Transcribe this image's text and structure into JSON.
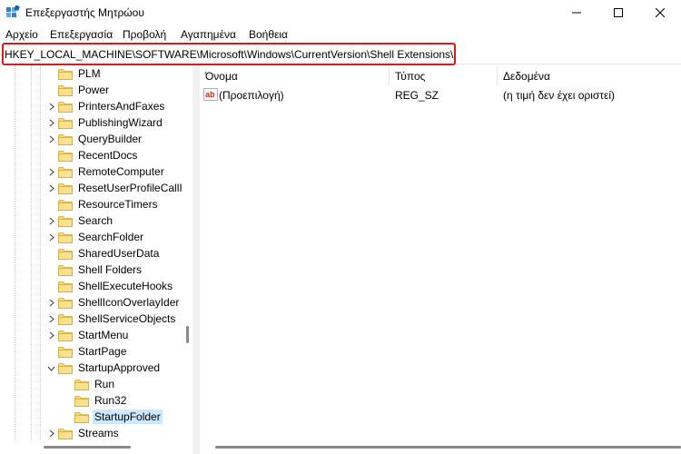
{
  "window": {
    "title": "Επεξεργαστής Μητρώου",
    "controls": {
      "minimize_icon": "minimize-icon",
      "maximize_icon": "maximize-icon",
      "close_icon": "close-icon"
    }
  },
  "menu": [
    "Αρχείο",
    "Επεξεργασία",
    "Προβολή",
    "Αγαπημένα",
    "Βοήθεια"
  ],
  "address": {
    "path": "HKEY_LOCAL_MACHINE\\SOFTWARE\\Microsoft\\Windows\\CurrentVersion\\Shell Extensions\\"
  },
  "tree": {
    "items": [
      {
        "label": "PLM",
        "expander": "none"
      },
      {
        "label": "Power",
        "expander": "none"
      },
      {
        "label": "PrintersAndFaxes",
        "expander": "collapsed"
      },
      {
        "label": "PublishingWizard",
        "expander": "collapsed"
      },
      {
        "label": "QueryBuilder",
        "expander": "collapsed"
      },
      {
        "label": "RecentDocs",
        "expander": "none"
      },
      {
        "label": "RemoteComputer",
        "expander": "collapsed"
      },
      {
        "label": "ResetUserProfileCallI",
        "expander": "collapsed"
      },
      {
        "label": "ResourceTimers",
        "expander": "none"
      },
      {
        "label": "Search",
        "expander": "collapsed"
      },
      {
        "label": "SearchFolder",
        "expander": "collapsed"
      },
      {
        "label": "SharedUserData",
        "expander": "none"
      },
      {
        "label": "Shell Folders",
        "expander": "none"
      },
      {
        "label": "ShellExecuteHooks",
        "expander": "none"
      },
      {
        "label": "ShellIconOverlayIder",
        "expander": "collapsed"
      },
      {
        "label": "ShellServiceObjects",
        "expander": "collapsed"
      },
      {
        "label": "StartMenu",
        "expander": "collapsed"
      },
      {
        "label": "StartPage",
        "expander": "none"
      },
      {
        "label": "StartupApproved",
        "expander": "expanded"
      },
      {
        "label": "Run",
        "expander": "none"
      },
      {
        "label": "Run32",
        "expander": "none"
      },
      {
        "label": "StartupFolder",
        "expander": "none",
        "selected": true
      },
      {
        "label": "Streams",
        "expander": "collapsed"
      }
    ]
  },
  "list": {
    "columns": [
      "Όνομα",
      "Τύπος",
      "Δεδομένα"
    ],
    "rows": [
      {
        "icon": "string-value-icon",
        "name": "(Προεπιλογή)",
        "type": "REG_SZ",
        "data": "(η τιμή δεν έχει οριστεί)"
      }
    ]
  },
  "colors": {
    "selection": "#cce8ff",
    "highlight_box": "#e0181e",
    "folder": "#f8d775"
  }
}
